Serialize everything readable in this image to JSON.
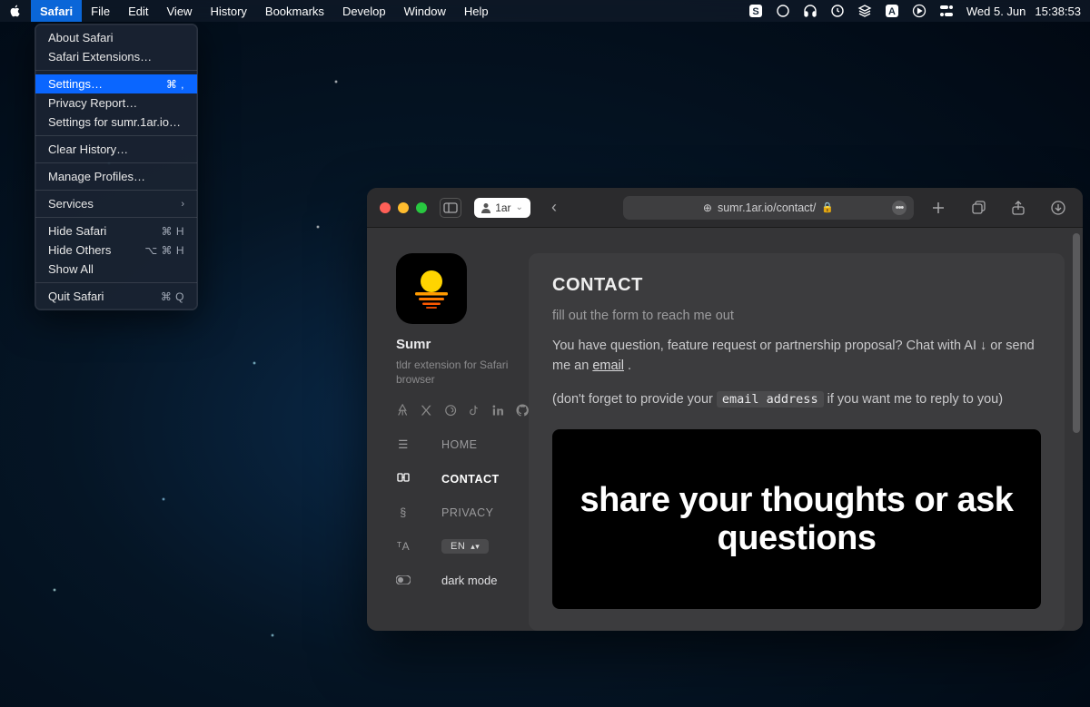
{
  "menubar": {
    "items": [
      "Safari",
      "File",
      "Edit",
      "View",
      "History",
      "Bookmarks",
      "Develop",
      "Window",
      "Help"
    ],
    "date": "Wed 5. Jun",
    "time": "15:38:53"
  },
  "dropdown": {
    "about": "About Safari",
    "extensions": "Safari Extensions…",
    "settings": "Settings…",
    "settings_short": "⌘ ,",
    "privacy_report": "Privacy Report…",
    "settings_for": "Settings for sumr.1ar.io…",
    "clear_history": "Clear History…",
    "manage_profiles": "Manage Profiles…",
    "services": "Services",
    "hide_safari": "Hide Safari",
    "hide_safari_short": "⌘ H",
    "hide_others": "Hide Others",
    "hide_others_short": "⌥ ⌘ H",
    "show_all": "Show All",
    "quit": "Quit Safari",
    "quit_short": "⌘ Q"
  },
  "safari": {
    "tab_label": "1ar",
    "url": "sumr.1ar.io/contact/",
    "sidebar": {
      "app_name": "Sumr",
      "app_sub": "tldr extension for Safari browser",
      "nav_home": "HOME",
      "nav_contact": "CONTACT",
      "nav_privacy": "PRIVACY",
      "lang": "EN",
      "dark_mode": "dark mode"
    },
    "main": {
      "title": "CONTACT",
      "subtitle": "fill out the form to reach me out",
      "para1_a": "You have question, feature request or partnership proposal? Chat with AI ↓ or send me an ",
      "para1_link": "email",
      "para1_b": " .",
      "para2_a": "(don't forget to provide your ",
      "para2_code": "email address",
      "para2_b": " if you want me to reply to you)",
      "chat_placeholder": "share your thoughts or ask questions"
    }
  }
}
